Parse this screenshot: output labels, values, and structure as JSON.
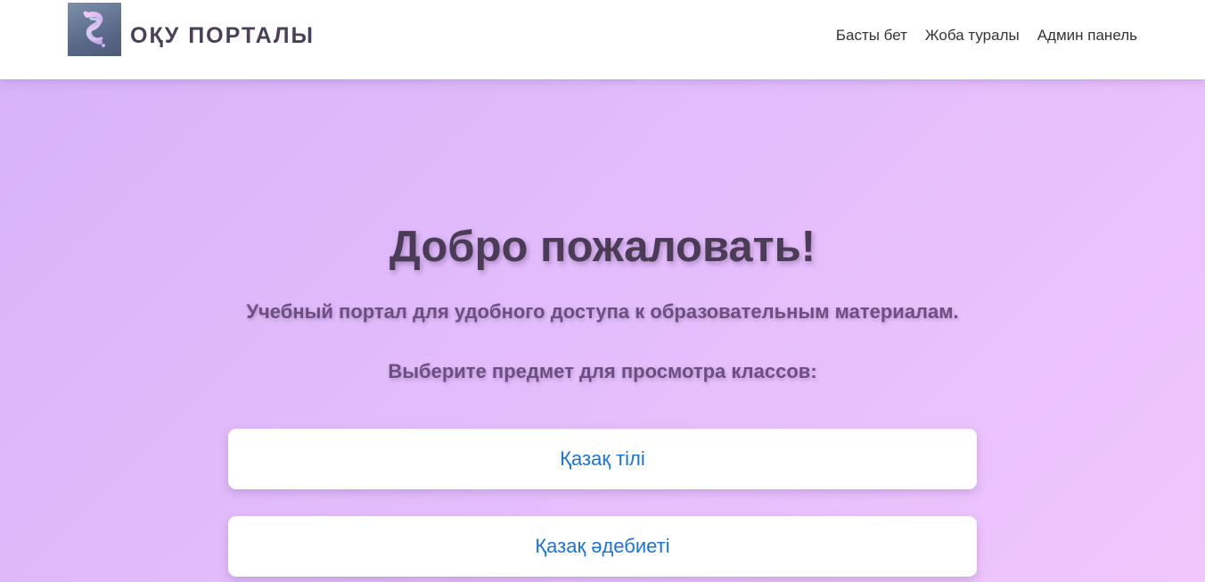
{
  "header": {
    "logo_alt": "logo",
    "brand": "ОҚУ ПОРТАЛЫ",
    "nav": [
      {
        "label": "Басты бет"
      },
      {
        "label": "Жоба туралы"
      },
      {
        "label": "Админ панель"
      }
    ]
  },
  "hero": {
    "title": "Добро пожаловать!",
    "subtitle": "Учебный портал для удобного доступа к образовательным материалам.",
    "prompt": "Выберите предмет для просмотра классов:"
  },
  "subjects": [
    {
      "label": "Қазақ тілі"
    },
    {
      "label": "Қазақ әдебиеті"
    }
  ],
  "colors": {
    "accent_link": "#1a73d9",
    "brand_text": "#4a3f58",
    "background_start": "#d6b2f8",
    "background_end": "#f0c6fc"
  }
}
